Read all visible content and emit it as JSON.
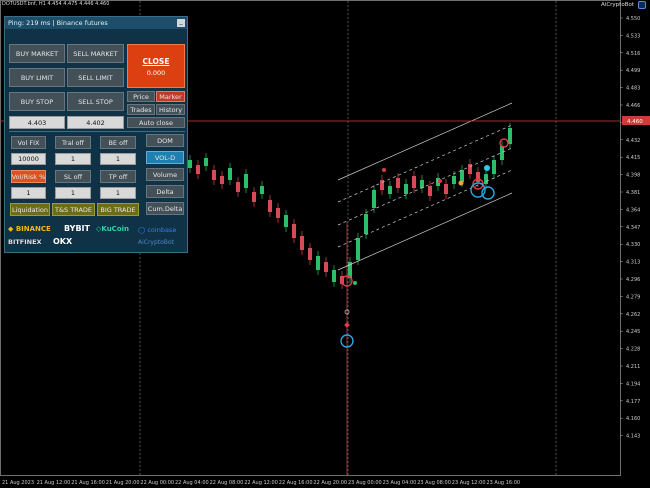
{
  "header": {
    "symbol_line": "DOTUSDT.bnf, H1  4.454 4.475 4.446 4.460",
    "brand": "AiCryptoBot"
  },
  "panel": {
    "title": "Ping: 219 ms | Binance futures",
    "minimize": "_",
    "buy_market": "BUY MARKET",
    "sell_market": "SELL MARKET",
    "buy_limit": "BUY LIMIT",
    "sell_limit": "SELL LIMIT",
    "buy_stop": "BUY STOP",
    "sell_stop": "SELL STOP",
    "close_label": "CLOSE",
    "close_value": "0.000",
    "price": "Price",
    "marker": "Marker",
    "trades": "Trades",
    "history": "History",
    "auto_close": "Auto close",
    "buy_price": "4.403",
    "sell_price": "4.402",
    "vol_fix": "Vol FIX",
    "tral_off": "Tral off",
    "be_off": "BE off",
    "dom": "DOM",
    "vol_fix_value": "10000",
    "tral_value": "1",
    "be_value": "1",
    "vol_d": "VOL-D",
    "vol_risk": "Vol/Risk %",
    "sl_off": "SL off",
    "tp_off": "TP off",
    "volume": "Volume",
    "risk_value": "1",
    "sl_value": "1",
    "tp_value": "1",
    "delta": "Delta",
    "liquidation": "Liquidation",
    "ts_trade": "T&S TRADE",
    "big_trade": "BIG TRADE",
    "cum_delta": "Cum.Delta"
  },
  "logos": {
    "binance": "BINANCE",
    "bybit": "BYBIT",
    "kucoin": "KuCoin",
    "coinbase": "coinbase",
    "bitfinex": "BITFINEX",
    "okx": "OKX",
    "aicryptobot": "AiCryptoBot"
  },
  "price_axis": {
    "labels": [
      "4.550",
      "4.533",
      "4.516",
      "4.499",
      "4.483",
      "4.466",
      "4.449",
      "4.432",
      "4.415",
      "4.398",
      "4.381",
      "4.364",
      "4.347",
      "4.330",
      "4.313",
      "4.296",
      "4.279",
      "4.262",
      "4.245",
      "4.228",
      "4.211",
      "4.194",
      "4.177",
      "4.160",
      "4.143"
    ],
    "current": "4.460",
    "current_color": "#d23a3a"
  },
  "time_axis": {
    "labels": [
      "21 Aug 2023",
      "21 Aug 12:00",
      "21 Aug 16:00",
      "21 Aug 20:00",
      "22 Aug 00:00",
      "22 Aug 04:00",
      "22 Aug 08:00",
      "22 Aug 12:00",
      "22 Aug 16:00",
      "22 Aug 20:00",
      "23 Aug 00:00",
      "23 Aug 04:00",
      "23 Aug 08:00",
      "23 Aug 12:00",
      "23 Aug 16:00"
    ]
  },
  "colors": {
    "bull": "#2dbe6a",
    "bear": "#d64b57",
    "channel": "#cfcfcf",
    "current_line": "#d23a3a"
  }
}
